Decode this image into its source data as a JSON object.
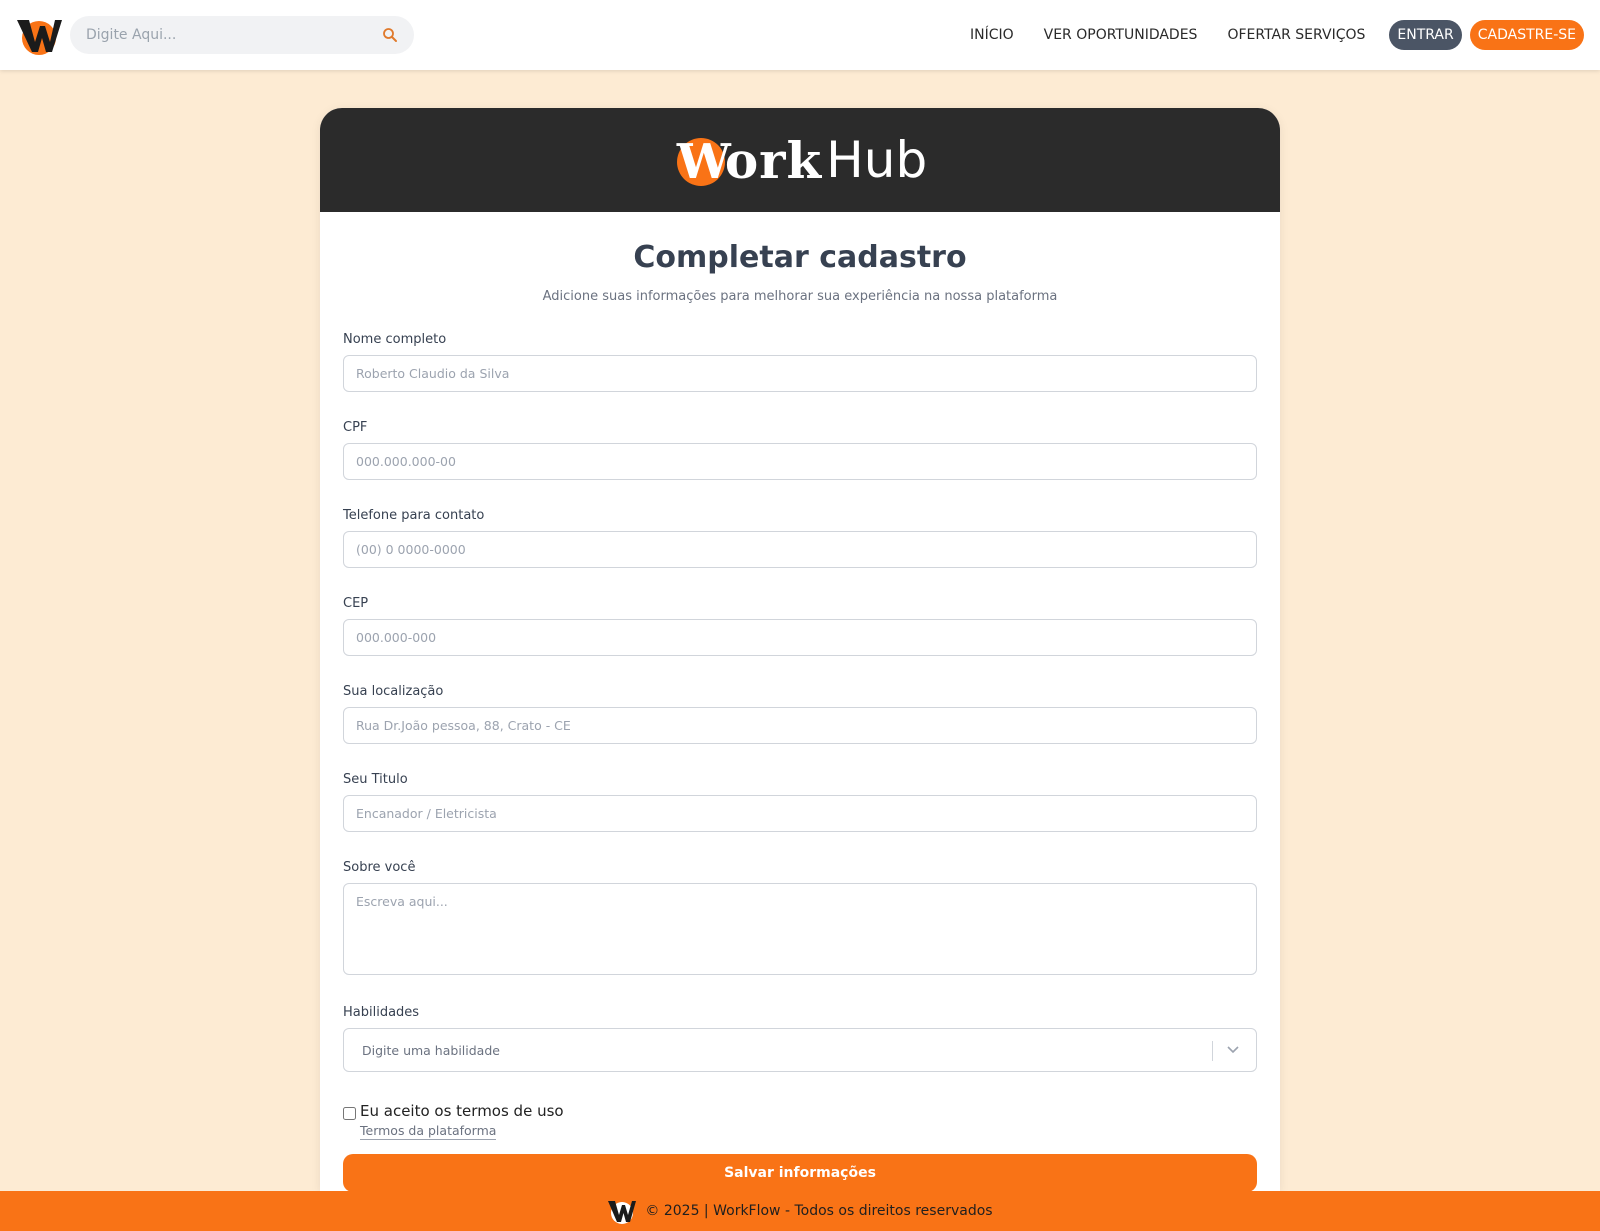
{
  "header": {
    "search_placeholder": "Digite Aqui...",
    "nav": [
      "INÍCIO",
      "VER OPORTUNIDADES",
      "OFERTAR SERVIÇOS"
    ],
    "login_label": "ENTRAR",
    "signup_label": "CADASTRE-SE"
  },
  "brand": {
    "w": "W",
    "ork": "ork",
    "hub": "Hub"
  },
  "form": {
    "title": "Completar cadastro",
    "subtitle": "Adicione suas informações para melhorar sua experiência na nossa plataforma",
    "fields": [
      {
        "label": "Nome completo",
        "placeholder": "Roberto Claudio da Silva"
      },
      {
        "label": "CPF",
        "placeholder": "000.000.000-00"
      },
      {
        "label": "Telefone para contato",
        "placeholder": "(00) 0 0000-0000"
      },
      {
        "label": "CEP",
        "placeholder": "000.000-000"
      },
      {
        "label": "Sua localização",
        "placeholder": "Rua Dr.João pessoa, 88, Crato - CE"
      },
      {
        "label": "Seu Titulo",
        "placeholder": "Encanador / Eletricista"
      }
    ],
    "about": {
      "label": "Sobre você",
      "placeholder": "Escreva aqui..."
    },
    "skills": {
      "label": "Habilidades",
      "placeholder": "Digite uma habilidade"
    },
    "terms": {
      "text": "Eu aceito os termos de uso",
      "link": "Termos da plataforma"
    },
    "submit_label": "Salvar informações"
  },
  "footer": {
    "text": "© 2025 | WorkFlow - Todos os direitos reservados"
  },
  "colors": {
    "accent": "#f97316",
    "dark": "#2b2b2b",
    "background": "#fdebd3",
    "login_button": "#4b5565"
  },
  "icons": [
    "workhub-logo-icon",
    "search-icon",
    "chevron-down-icon"
  ]
}
